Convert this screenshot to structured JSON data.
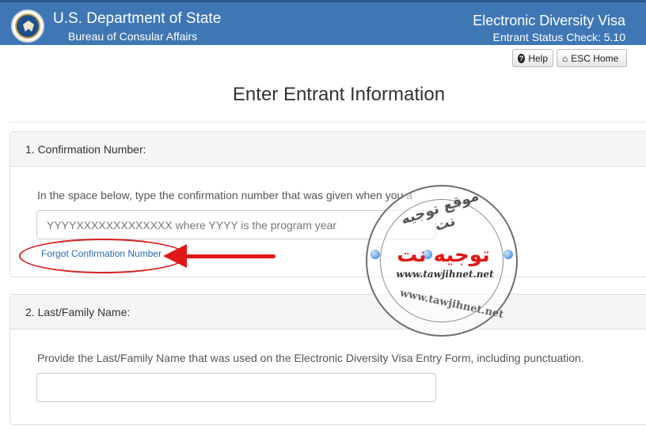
{
  "header": {
    "title": "U.S. Department of State",
    "subtitle": "Bureau of Consular Affairs",
    "app_title": "Electronic Diversity Visa",
    "app_subtitle": "Entrant Status Check: 5.10"
  },
  "toolbar": {
    "help_label": "Help",
    "home_label": "ESC Home"
  },
  "page": {
    "title": "Enter Entrant Information"
  },
  "section1": {
    "heading": "1. Confirmation Number:",
    "instruction": "In the space below, type the confirmation number that was given when you a",
    "placeholder": "YYYYXXXXXXXXXXXXX where YYYY is the program year",
    "forgot_link": "Forgot Confirmation Number"
  },
  "section2": {
    "heading": "2. Last/Family Name:",
    "instruction": "Provide the Last/Family Name that was used on the Electronic Diversity Visa Entry Form, including punctuation.",
    "value": ""
  },
  "watermark": {
    "arabic_top": "موقع توجيه نت",
    "logo": "توجيه نت",
    "url": "www.tawjihnet.net",
    "ring": "www.tawjihnet.net"
  },
  "colors": {
    "header_bg": "#3f77b4",
    "link": "#2a6ab3",
    "annotation": "#e01818"
  }
}
